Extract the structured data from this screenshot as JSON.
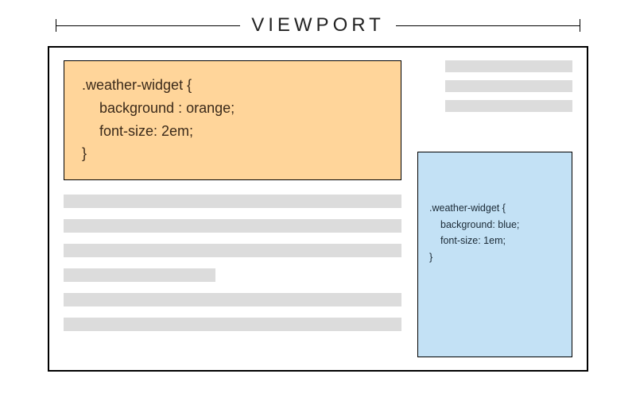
{
  "label": "VIEWPORT",
  "orange_widget": {
    "selector": ".weather-widget {",
    "rule_background": "background : orange;",
    "rule_fontsize": "font-size: 2em;",
    "close": "}"
  },
  "blue_widget": {
    "selector": ".weather-widget {",
    "rule_background": "background: blue;",
    "rule_fontsize": "font-size: 1em;",
    "close": "}"
  }
}
